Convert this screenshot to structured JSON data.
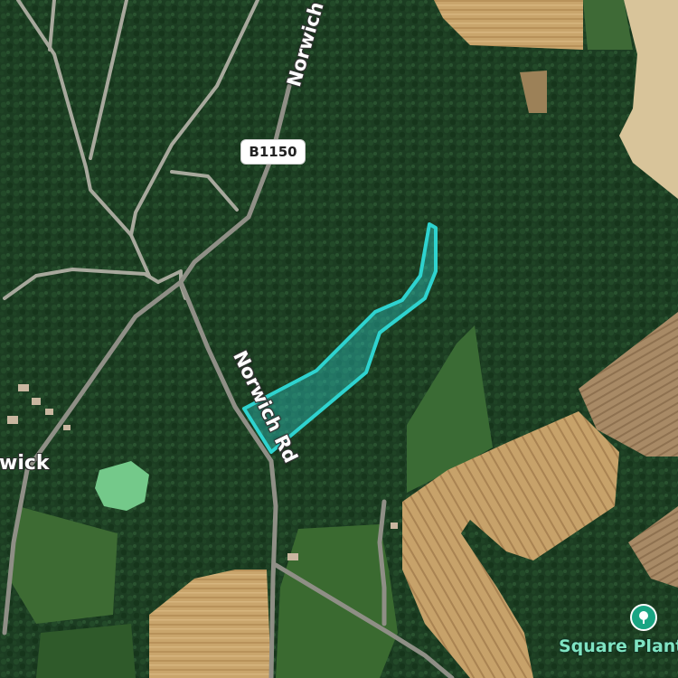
{
  "map": {
    "type": "satellite",
    "road_shield": "B1150",
    "road_labels": [
      "Norwich",
      "Norwich Rd"
    ],
    "place_label": "wick",
    "poi": {
      "label": "Square Plant",
      "icon": "tree-icon",
      "color": "#1aa583"
    },
    "selection_color": "#2ed3cf"
  }
}
